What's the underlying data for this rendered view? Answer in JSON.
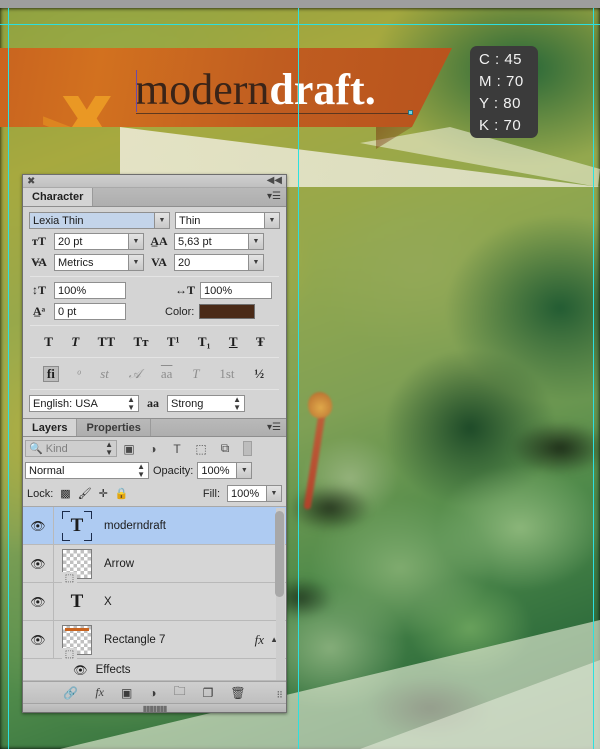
{
  "artwork": {
    "logo": {
      "light": "modern",
      "bold": "draft",
      "dot": "."
    },
    "cmyk": {
      "c": "C : 45",
      "m": "M : 70",
      "y": "Y : 80",
      "k": "K : 70"
    }
  },
  "character_panel": {
    "close_glyph": "✖",
    "collapse_glyph": "◀◀",
    "tab_label": "Character",
    "menu_glyph": "▾☰",
    "font_family": {
      "value": "Lexia Thin",
      "placeholder": "Font family"
    },
    "font_style": {
      "value": "Thin",
      "placeholder": "Font style"
    },
    "font_size": {
      "icon": "size-icon",
      "value": "20 pt"
    },
    "leading": {
      "icon": "leading-icon",
      "value": "5,63 pt"
    },
    "kerning": {
      "icon": "kerning-icon",
      "value": "Metrics"
    },
    "tracking": {
      "icon": "tracking-icon",
      "value": "20"
    },
    "vertical_scale": {
      "icon": "vertical-scale-icon",
      "value": "100%"
    },
    "horizontal_scale": {
      "icon": "horizontal-scale-icon",
      "value": "100%"
    },
    "baseline_shift": {
      "icon": "baseline-shift-icon",
      "value": "0 pt"
    },
    "color_label": "Color:",
    "color_value": "#4a2a17",
    "style_buttons": [
      {
        "name": "faux-bold",
        "glyph": "T"
      },
      {
        "name": "faux-italic",
        "glyph": "T"
      },
      {
        "name": "all-caps",
        "glyph": "TT"
      },
      {
        "name": "small-caps",
        "glyph": "Tᴛ"
      },
      {
        "name": "superscript",
        "glyph": "T¹"
      },
      {
        "name": "subscript",
        "glyph": "T₁"
      },
      {
        "name": "underline",
        "glyph": "T"
      },
      {
        "name": "strikethrough",
        "glyph": "Ŧ"
      }
    ],
    "opentype_buttons": [
      {
        "name": "standard-ligatures",
        "glyph": "fi"
      },
      {
        "name": "contextual-alternates",
        "glyph": "ᵒ"
      },
      {
        "name": "discretionary-ligatures",
        "glyph": "st"
      },
      {
        "name": "swash",
        "glyph": "𝒜"
      },
      {
        "name": "oldstyle",
        "glyph": "aa"
      },
      {
        "name": "titling-alternates",
        "glyph": "T"
      },
      {
        "name": "ordinals",
        "glyph": "1st"
      },
      {
        "name": "fractions",
        "glyph": "½"
      }
    ],
    "language": {
      "value": "English: USA"
    },
    "antialias_icon": "aa",
    "antialias": {
      "value": "Strong"
    }
  },
  "layers_panel": {
    "tabs": [
      {
        "label": "Layers",
        "active": true
      },
      {
        "label": "Properties",
        "active": false
      }
    ],
    "menu_glyph": "▾☰",
    "filter": {
      "kind_label": "Kind",
      "search_icon": "search-icon",
      "stepper_glyph": "⇕",
      "icons": [
        {
          "name": "filter-pixel-icon",
          "glyph": "▣"
        },
        {
          "name": "filter-adjustment-icon",
          "glyph": "◑"
        },
        {
          "name": "filter-type-icon",
          "glyph": "T"
        },
        {
          "name": "filter-shape-icon",
          "glyph": "⬚"
        },
        {
          "name": "filter-smart-object-icon",
          "glyph": "⧉"
        }
      ]
    },
    "blend_mode": {
      "value": "Normal"
    },
    "opacity_label": "Opacity:",
    "opacity": {
      "value": "100%"
    },
    "lock_label": "Lock:",
    "lock_icons": [
      {
        "name": "lock-transparency-icon",
        "glyph": "▩"
      },
      {
        "name": "lock-image-icon",
        "glyph": "🖌"
      },
      {
        "name": "lock-position-icon",
        "glyph": "✛"
      },
      {
        "name": "lock-all-icon",
        "glyph": "🔒"
      }
    ],
    "fill_label": "Fill:",
    "fill": {
      "value": "100%"
    },
    "layers": [
      {
        "name": "moderndraft",
        "type": "text",
        "selected": true,
        "visible": true,
        "eye": "👁",
        "fx": ""
      },
      {
        "name": "Arrow",
        "type": "smart",
        "selected": false,
        "visible": true,
        "eye": "👁",
        "fx": ""
      },
      {
        "name": "X",
        "type": "text",
        "selected": false,
        "visible": true,
        "eye": "👁",
        "fx": ""
      },
      {
        "name": "Rectangle 7",
        "type": "smart",
        "selected": false,
        "visible": true,
        "eye": "👁",
        "fx": "fx"
      }
    ],
    "effects_row": {
      "label": "Effects",
      "eye": "👁"
    },
    "footer_icons": [
      {
        "name": "link-layers-icon",
        "glyph": "🔗"
      },
      {
        "name": "add-layer-style-icon",
        "glyph": "fx"
      },
      {
        "name": "add-layer-mask-icon",
        "glyph": "▣"
      },
      {
        "name": "new-adjustment-layer-icon",
        "glyph": "◑"
      },
      {
        "name": "new-group-icon",
        "glyph": "🗀"
      },
      {
        "name": "new-layer-icon",
        "glyph": "❐"
      },
      {
        "name": "delete-layer-icon",
        "glyph": "🗑"
      }
    ]
  }
}
